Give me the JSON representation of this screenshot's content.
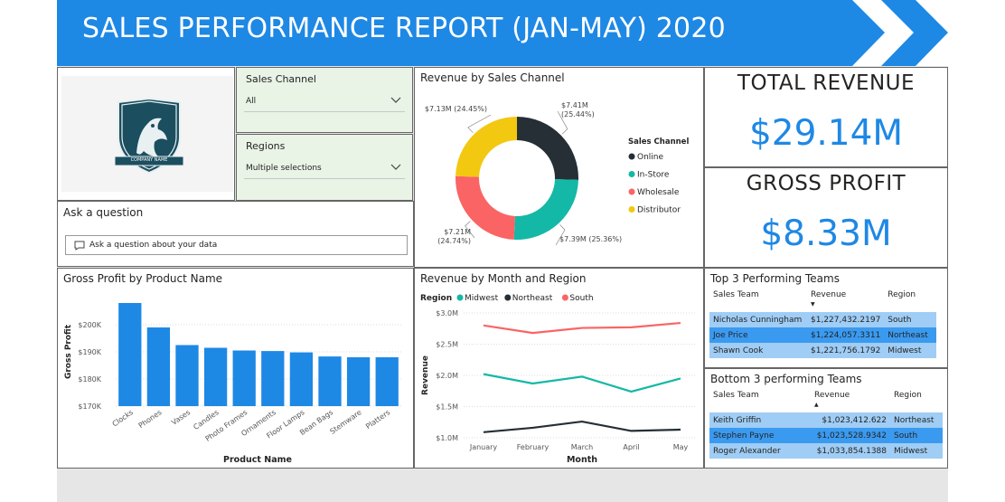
{
  "header": {
    "title": "SALES PERFORMANCE REPORT (JAN-MAY) 2020"
  },
  "logo": {
    "text": "COMPANY NAME",
    "alt": "company-logo"
  },
  "slicers": {
    "sales_channel": {
      "label": "Sales Channel",
      "value": "All"
    },
    "regions": {
      "label": "Regions",
      "value": "Multiple selections"
    }
  },
  "qa": {
    "label": "Ask a question",
    "placeholder": "Ask a question about your data"
  },
  "kpis": {
    "total_revenue": {
      "label": "TOTAL REVENUE",
      "value": "$29.14M"
    },
    "gross_profit": {
      "label": "GROSS PROFIT",
      "value": "$8.33M"
    }
  },
  "colors": {
    "accent": "#1e88e5",
    "online": "#252f35",
    "instore": "#14b8a6",
    "wholesale": "#fa6464",
    "distributor": "#f2c811"
  },
  "chart_data": [
    {
      "id": "revenue_by_channel",
      "type": "pie",
      "title": "Revenue by Sales Channel",
      "legend_title": "Sales Channel",
      "legend_position": "right",
      "slices": [
        {
          "name": "Online",
          "value": 7.41,
          "label": "$7.41M",
          "pct": "(25.44%)",
          "color": "#252f35"
        },
        {
          "name": "In-Store",
          "value": 7.39,
          "label": "$7.39M",
          "pct": "(25.36%)",
          "color": "#14b8a6"
        },
        {
          "name": "Wholesale",
          "value": 7.21,
          "label": "$7.21M",
          "pct": "(24.74%)",
          "color": "#fa6464"
        },
        {
          "name": "Distributor",
          "value": 7.13,
          "label": "$7.13M",
          "pct": "(24.45%)",
          "color": "#f2c811"
        }
      ]
    },
    {
      "id": "gross_profit_by_product",
      "type": "bar",
      "title": "Gross Profit by Product Name",
      "xlabel": "Product Name",
      "ylabel": "Gross Profit",
      "ylim": [
        170000,
        210000
      ],
      "yticks": [
        170000,
        180000,
        190000,
        200000
      ],
      "ytick_labels": [
        "$170K",
        "$180K",
        "$190K",
        "$200K"
      ],
      "categories": [
        "Clocks",
        "Phones",
        "Vases",
        "Candles",
        "Photo Frames",
        "Ornaments",
        "Floor Lamps",
        "Bean Bags",
        "Stemware",
        "Platters"
      ],
      "values": [
        208000,
        199000,
        192500,
        191500,
        190500,
        190300,
        189800,
        188300,
        188000,
        188000
      ],
      "color": "#1e88e5",
      "grid": true
    },
    {
      "id": "revenue_by_month_region",
      "type": "line",
      "title": "Revenue by Month and Region",
      "legend_title": "Region",
      "legend_position": "top-left",
      "xlabel": "Month",
      "ylabel": "Revenue",
      "categories": [
        "January",
        "February",
        "March",
        "April",
        "May"
      ],
      "ylim": [
        1000000,
        3000000
      ],
      "yticks": [
        1000000,
        1500000,
        2000000,
        2500000,
        3000000
      ],
      "ytick_labels": [
        "$1.0M",
        "$1.5M",
        "$2.0M",
        "$2.5M",
        "$3.0M"
      ],
      "series": [
        {
          "name": "Midwest",
          "color": "#14b8a6",
          "values": [
            2020000,
            1870000,
            1980000,
            1740000,
            1950000
          ]
        },
        {
          "name": "Northeast",
          "color": "#252f35",
          "values": [
            1090000,
            1160000,
            1260000,
            1110000,
            1130000
          ]
        },
        {
          "name": "South",
          "color": "#fa6464",
          "values": [
            2800000,
            2680000,
            2760000,
            2770000,
            2840000
          ]
        }
      ],
      "grid": true
    }
  ],
  "top_teams": {
    "title": "Top 3 Performing Teams",
    "columns": [
      "Sales Team",
      "Revenue",
      "Region"
    ],
    "rows": [
      [
        "Nicholas Cunningham",
        "$1,227,432.2197",
        "South"
      ],
      [
        "Joe Price",
        "$1,224,057.3311",
        "Northeast"
      ],
      [
        "Shawn Cook",
        "$1,221,756.1792",
        "Midwest"
      ]
    ]
  },
  "bottom_teams": {
    "title": "Bottom 3 performing Teams",
    "columns": [
      "Sales Team",
      "Revenue",
      "Region"
    ],
    "rows": [
      [
        "Keith Griffin",
        "$1,023,412.622",
        "Northeast"
      ],
      [
        "Stephen Payne",
        "$1,023,528.9342",
        "South"
      ],
      [
        "Roger Alexander",
        "$1,033,854.1388",
        "Midwest"
      ]
    ]
  }
}
